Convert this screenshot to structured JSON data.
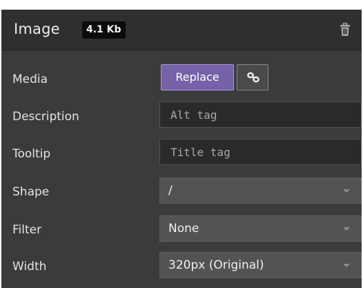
{
  "header": {
    "title": "Image",
    "size_badge": "4.1 Kb",
    "delete_icon": "trash-icon"
  },
  "rows": {
    "media": {
      "label": "Media",
      "replace_label": "Replace",
      "link_icon": "link-icon"
    },
    "description": {
      "label": "Description",
      "placeholder": "Alt tag",
      "value": ""
    },
    "tooltip": {
      "label": "Tooltip",
      "placeholder": "Title tag",
      "value": ""
    },
    "shape": {
      "label": "Shape",
      "selected": "/"
    },
    "filter": {
      "label": "Filter",
      "selected": "None"
    },
    "width": {
      "label": "Width",
      "selected": "320px (Original)"
    }
  },
  "colors": {
    "panel_bg": "#3b3b3d",
    "header_bg": "#2f2f31",
    "accent": "#7562a8"
  }
}
